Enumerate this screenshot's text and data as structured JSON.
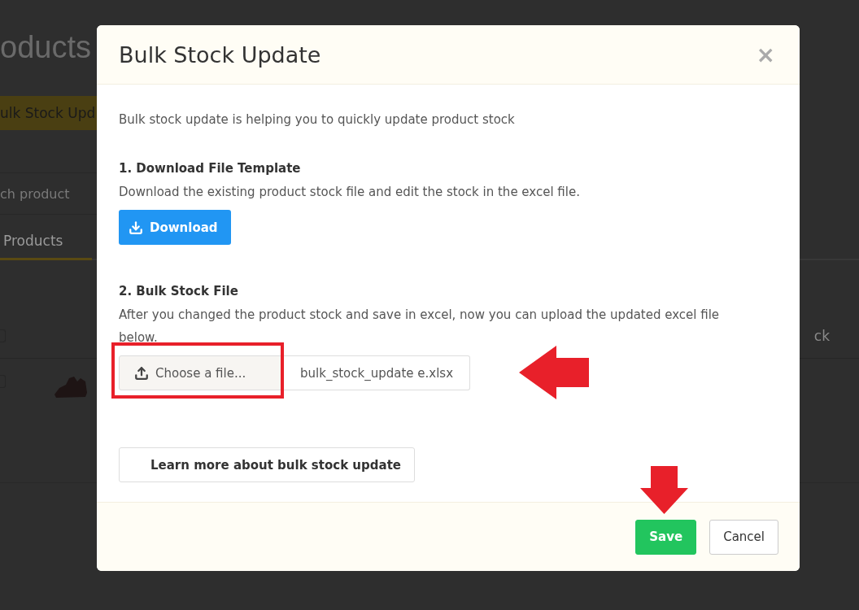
{
  "background_page": {
    "title": "oducts",
    "bulk_button": "ulk Stock Upd",
    "search": {
      "placeholder": "ch product"
    },
    "tabs": [
      {
        "label": "Products",
        "selected": true
      }
    ],
    "table": {
      "header_checked": false,
      "columns": [
        {
          "label": "ck"
        }
      ],
      "rows": [
        {
          "checked": false
        }
      ]
    }
  },
  "modal": {
    "title": "Bulk Stock Update",
    "close": "×",
    "intro": "Bulk stock update is helping you to quickly update product stock",
    "steps": [
      {
        "kind": "download",
        "heading": "1. Download File Template",
        "text": "Download the existing product stock file and edit the stock in the excel file.",
        "button": "Download"
      },
      {
        "kind": "file",
        "heading": "2. Bulk Stock File",
        "text": "After you changed the product stock and save in excel, now you can upload the updated excel file below.",
        "button": "Choose a file...",
        "file_name": "bulk_stock_update e.xlsx"
      }
    ],
    "learn_more": "Learn more about bulk stock update",
    "footer_buttons": [
      {
        "kind": "primary",
        "label": "Save"
      },
      {
        "kind": "default",
        "label": "Cancel"
      }
    ]
  }
}
